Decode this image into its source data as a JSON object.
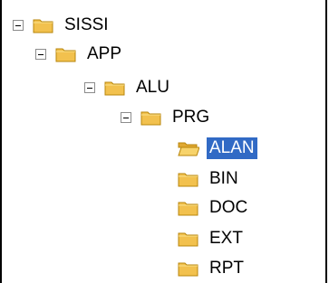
{
  "tree": {
    "nodes": [
      {
        "label": "SISSI",
        "expanded": true,
        "depth": 0
      },
      {
        "label": "APP",
        "expanded": true,
        "depth": 1
      },
      {
        "label": "ALU",
        "expanded": true,
        "depth": 2
      },
      {
        "label": "PRG",
        "expanded": true,
        "depth": 3
      },
      {
        "label": "ALAN",
        "depth": 4,
        "selected": true,
        "icon": "folder-open-icon"
      },
      {
        "label": "BIN",
        "depth": 4,
        "icon": "folder-icon"
      },
      {
        "label": "DOC",
        "depth": 4,
        "icon": "folder-icon"
      },
      {
        "label": "EXT",
        "depth": 4,
        "icon": "folder-icon"
      },
      {
        "label": "RPT",
        "depth": 4,
        "icon": "folder-icon"
      }
    ]
  },
  "colors": {
    "selection_bg": "#316ac5",
    "folder_yellow": "#f2c14e"
  }
}
